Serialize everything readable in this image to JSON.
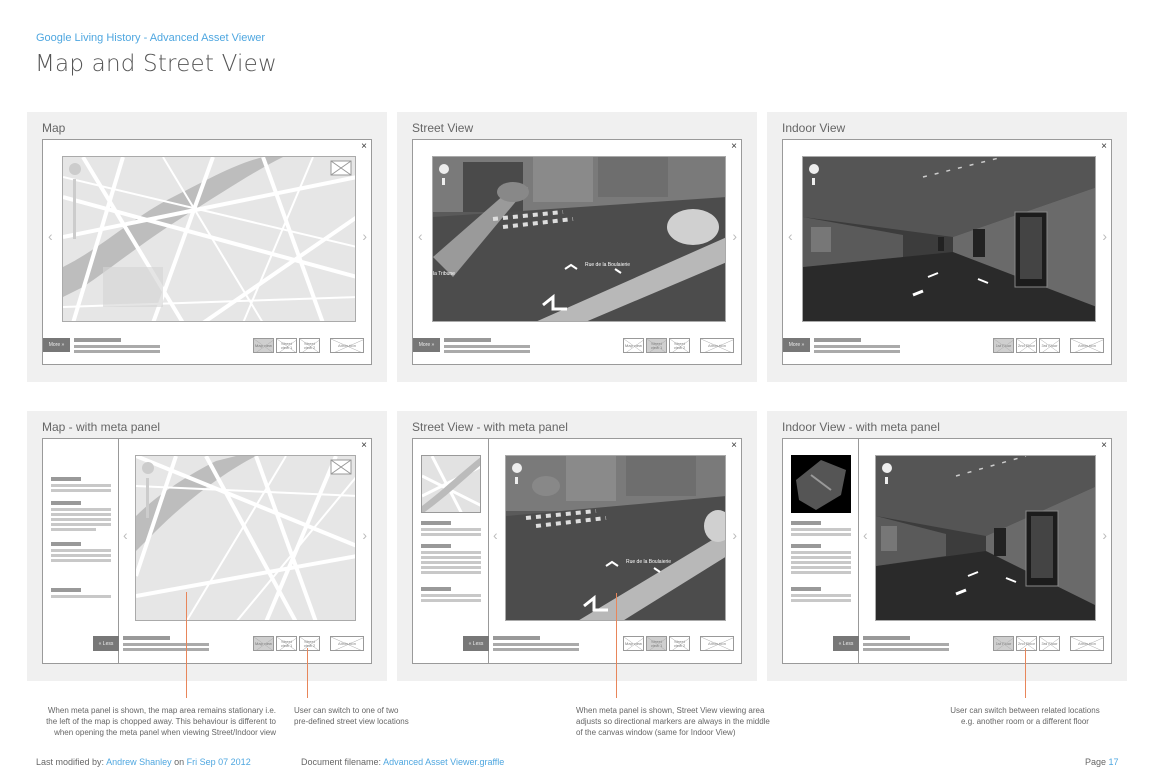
{
  "header": {
    "subtitle": "Google Living History - Advanced Asset Viewer",
    "title": "Map and Street View"
  },
  "panels": [
    {
      "label": "Map",
      "more": "More »",
      "thumbs": [
        "Map view",
        "Street view 1",
        "Street view 2"
      ],
      "attribution": "Attribution"
    },
    {
      "label": "Street View",
      "more": "More »",
      "thumbs": [
        "Map view",
        "Street view 1",
        "Street view 2"
      ],
      "attribution": "Attribution"
    },
    {
      "label": "Indoor View",
      "more": "More »",
      "thumbs": [
        "1st Floor",
        "2nd Floor",
        "3rd Floor"
      ],
      "attribution": "Attribution"
    },
    {
      "label": "Map - with meta panel",
      "less": "« Less",
      "thumbs": [
        "Map view",
        "Street view 1",
        "Street view 2"
      ],
      "attribution": "Attribution"
    },
    {
      "label": "Street View - with meta panel",
      "less": "« Less",
      "thumbs": [
        "Map view",
        "Street view 1",
        "Street view 2"
      ],
      "attribution": "Attribution"
    },
    {
      "label": "Indoor View - with meta panel",
      "less": "« Less",
      "thumbs": [
        "1st Floor",
        "2nd Floor",
        "3rd Floor"
      ],
      "attribution": "Attribution"
    }
  ],
  "street_labels": {
    "rue": "Rue de la Boulaierie",
    "place": "la Tribune"
  },
  "annotations": [
    {
      "lines": [
        "When meta panel is shown, the map area remains stationary i.e.",
        "the left of the map is chopped away. This behaviour is different to",
        "when opening the meta panel when viewing Street/Indoor view"
      ]
    },
    {
      "lines": [
        "User can switch to one of two",
        "pre-defined street view locations"
      ]
    },
    {
      "lines": [
        "When meta panel is shown, Street View viewing area",
        "adjusts so directional markers are always in the middle",
        "of the canvas window (same for Indoor View)"
      ]
    },
    {
      "lines": [
        "User can switch between related locations",
        "e.g. another room or a different floor"
      ]
    }
  ],
  "footer": {
    "modified_label": "Last modified by:",
    "author": "Andrew Shanley",
    "on": "on",
    "date": "Fri Sep 07 2012",
    "doc_label": "Document filename:",
    "filename": "Advanced Asset Viewer.graffle",
    "page_label": "Page",
    "page_number": "17"
  },
  "icons": {
    "close": "×",
    "left": "‹",
    "right": "›"
  },
  "colors": {
    "accent": "#4fa7e0",
    "annotation_line": "#e8865a"
  }
}
